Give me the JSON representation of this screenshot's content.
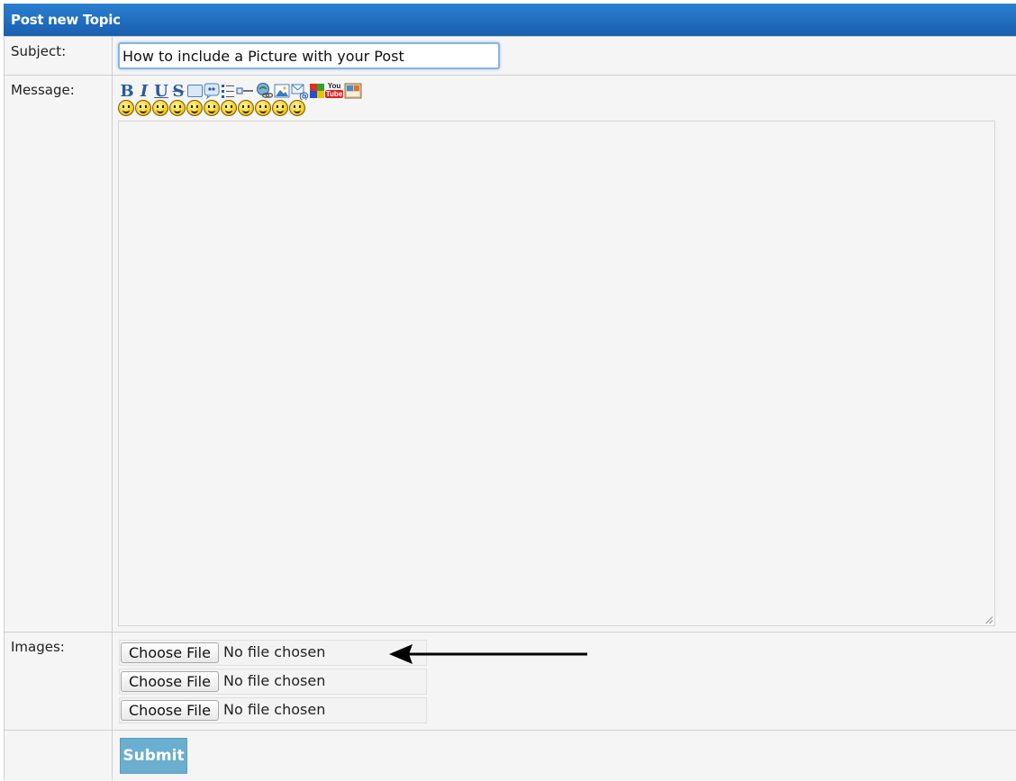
{
  "form": {
    "title": "Post new Topic",
    "subject_label": "Subject:",
    "subject_value": "How to include a Picture with your Post",
    "message_label": "Message:",
    "images_label": "Images:",
    "submit_label": "Submit"
  },
  "toolbar": {
    "bold": "B",
    "italic": "I",
    "underline": "U",
    "strike": "S",
    "youtube_you": "You",
    "youtube_tube": "Tube"
  },
  "files": [
    {
      "button": "Choose File",
      "status": "No file chosen"
    },
    {
      "button": "Choose File",
      "status": "No file chosen"
    },
    {
      "button": "Choose File",
      "status": "No file chosen"
    }
  ],
  "colors": {
    "header_blue": "#1a5fb0",
    "submit_blue": "#6aaed0",
    "panel_gray": "#f5f5f5"
  }
}
